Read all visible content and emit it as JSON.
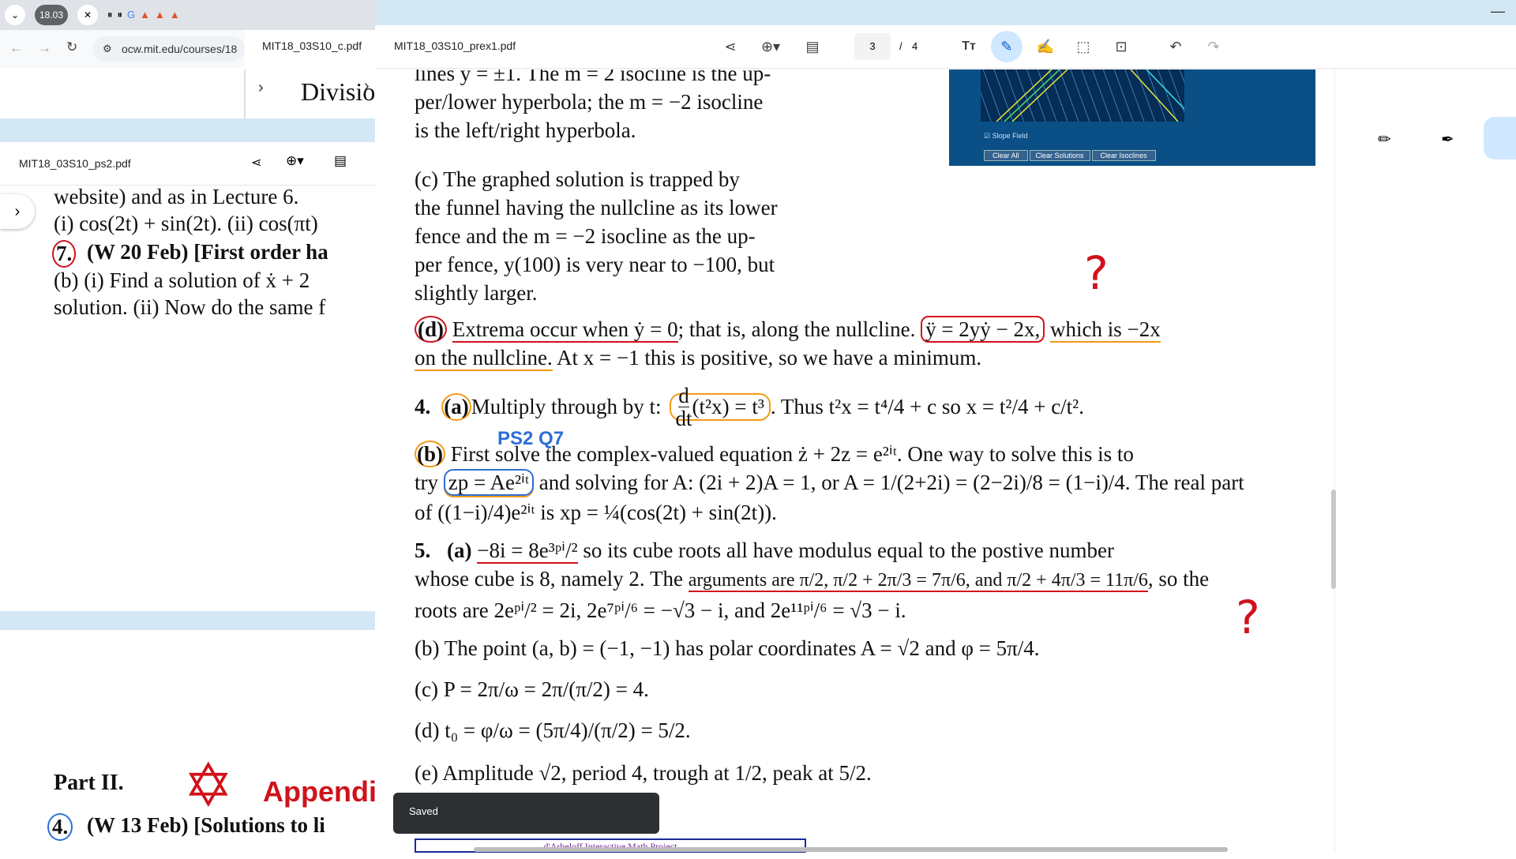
{
  "browser": {
    "time_badge": "18.03",
    "address": "ocw.mit.edu/courses/18"
  },
  "windows": {
    "c_title": "MIT18_03S10_c.pdf",
    "c_snippet": "Divisio",
    "ps2_title": "MIT18_03S10_ps2.pdf",
    "ps2_lines": [
      "website) and as in Lecture 6.",
      "(i) cos(2t) + sin(2t).  (ii) cos(πt)",
      "(W 20 Feb) [First order ha",
      "(b) (i) Find a solution of ẋ + 2",
      "solution.  (ii) Now do the same f"
    ],
    "ps2_item_num": "7.",
    "part2": "Part II.",
    "appendix": "Appendix",
    "ps2_item4_num": "4.",
    "ps2_item4_text": "(W 13 Feb) [Solutions to li"
  },
  "pdf": {
    "title": "MIT18_03S10_prex1.pdf",
    "page_current": "3",
    "page_sep": "/",
    "page_total": "4"
  },
  "content": {
    "l1": "lines y = ±1. The m = 2 isocline is the up-",
    "l2": "per/lower hyperbola; the m = −2 isocline",
    "l3": "is the left/right hyperbola.",
    "c1": "(c) The graphed solution is trapped by",
    "c2": "the funnel having the nullcline as its lower",
    "c3": "fence and the m = −2 isocline as the up-",
    "c4": "per fence, y(100) is very near to −100, but",
    "c5": "slightly larger.",
    "d_label": "(d)",
    "d1a": "Extrema occur when ẏ = 0",
    "d1b": "; that is, along the nullcline.",
    "d1c": "ÿ = 2yẏ − 2x,",
    "d1d": "which is −2x",
    "d2a": "on the nullcline.",
    "d2b": " At x = −1 this is positive, so we have a minimum.",
    "q4_num": "4.",
    "q4_a": "(a)",
    "q4_text": " Multiply through by t:",
    "q4_frac_num": "d",
    "q4_frac_den": "dt",
    "q4_eq": "(t²x) = t³",
    "q4_tail": ". Thus t²x = t⁴/4 + c so x = t²/4 + c/t².",
    "ps2_note": "PS2 Q7",
    "q4b_label": "(b)",
    "q4b_line1": " First solve the complex-valued equation ż + 2z = e²ⁱᵗ. One way to solve this is to",
    "q4b_line2a": "try ",
    "q4b_line2b": "zp = Ae²ⁱᵗ",
    "q4b_line2c": " and solving for A: (2i + 2)A = 1, or A = 1/(2+2i) = (2−2i)/8 = (1−i)/4. The real part",
    "q4b_line3": "of ((1−i)/4)e²ⁱᵗ is xp = ¼(cos(2t) + sin(2t)).",
    "q5_num": "5.",
    "q5_a": "(a)",
    "q5_eq": "−8i = 8e³ᵖⁱ/²",
    "q5_line1": " so its cube roots all have modulus equal to the postive number",
    "q5_line2a": "whose cube is 8, namely 2. The ",
    "q5_line2b": "arguments are π/2, π/2 + 2π/3 = 7π/6, and π/2 + 4π/3 = 11π/6",
    "q5_line2c": ", so the",
    "q5_line3": "roots are 2eᵖⁱ/² = 2i, 2e⁷ᵖⁱ/⁶ = −√3 − i, and 2e¹¹ᵖⁱ/⁶ = √3 − i.",
    "q5b": "(b) The point (a, b) = (−1, −1) has polar coordinates A = √2 and φ = 5π/4.",
    "q5c": "(c) P = 2π/ω = 2π/(π/2) = 4.",
    "q5d": "(d) t₀ = φ/ω = (5π/4)/(π/2) = 5/2.",
    "q5e": "(e) Amplitude √2, period 4, trough at 1/2, peak at 5/2.",
    "footer_label": "d'Arbeloff Interactive Math Project"
  },
  "applet": {
    "slope_field_label": "Slope Field",
    "buttons": [
      "Clear All",
      "Clear Solutions",
      "Clear Isoclines"
    ]
  },
  "toast": {
    "text": "Saved"
  },
  "icons": [
    "chevron-down-icon",
    "close-icon",
    "back-icon",
    "forward-icon",
    "reload-icon",
    "site-info-icon",
    "share-icon",
    "zoom-icon",
    "print-icon",
    "text-icon",
    "pen-icon",
    "signature-icon",
    "select-icon",
    "screenshot-icon",
    "undo-icon",
    "redo-icon",
    "pencil-icon",
    "marker-icon",
    "minimize-icon",
    "chevron-right-icon"
  ],
  "colors": {
    "annotation_red": "#d0121b",
    "annotation_orange": "#f39a16",
    "annotation_blue": "#2d6fd6",
    "applet_bg": "#0a4f86"
  }
}
